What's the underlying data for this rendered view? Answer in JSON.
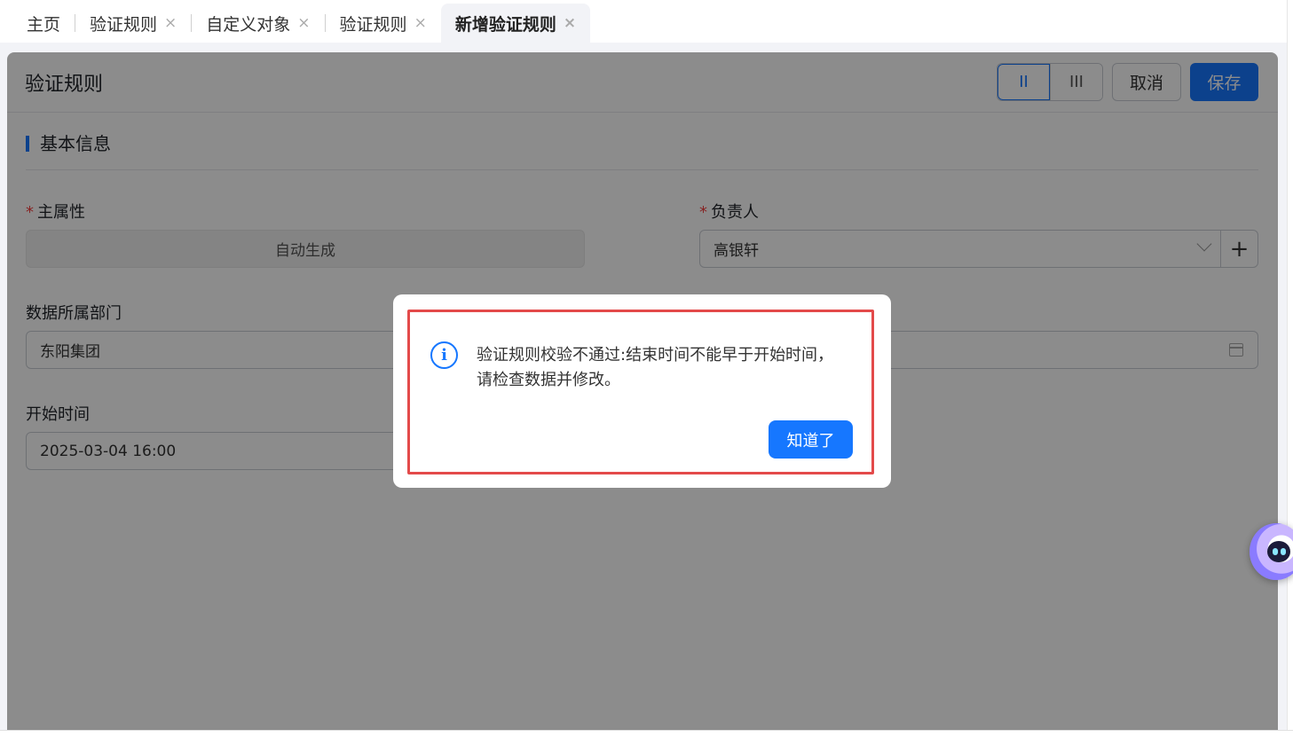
{
  "tabs": [
    {
      "label": "主页",
      "closable": false,
      "active": false
    },
    {
      "label": "验证规则",
      "closable": true,
      "active": false
    },
    {
      "label": "自定义对象",
      "closable": true,
      "active": false
    },
    {
      "label": "验证规则",
      "closable": true,
      "active": false
    },
    {
      "label": "新增验证规则",
      "closable": true,
      "active": true
    }
  ],
  "close_glyph": "×",
  "header": {
    "title": "验证规则",
    "layout_two_col": "II",
    "layout_three_col": "III",
    "cancel_label": "取消",
    "save_label": "保存"
  },
  "section": {
    "title": "基本信息"
  },
  "form": {
    "required_mark": "*",
    "primary_attr": {
      "label": "主属性",
      "value": "自动生成"
    },
    "owner": {
      "label": "负责人",
      "value": "高银轩",
      "add": "+"
    },
    "department": {
      "label": "数据所属部门",
      "value": "东阳集团"
    },
    "start_time": {
      "label": "开始时间",
      "value": "2025-03-04 16:00"
    }
  },
  "dialog": {
    "icon": "i",
    "message": "验证规则校验不通过:结束时间不能早于开始时间，请检查数据并修改。",
    "ok_label": "知道了"
  },
  "colors": {
    "primary": "#1677ff",
    "required": "#f53f3f",
    "highlight": "#e34a4a"
  }
}
